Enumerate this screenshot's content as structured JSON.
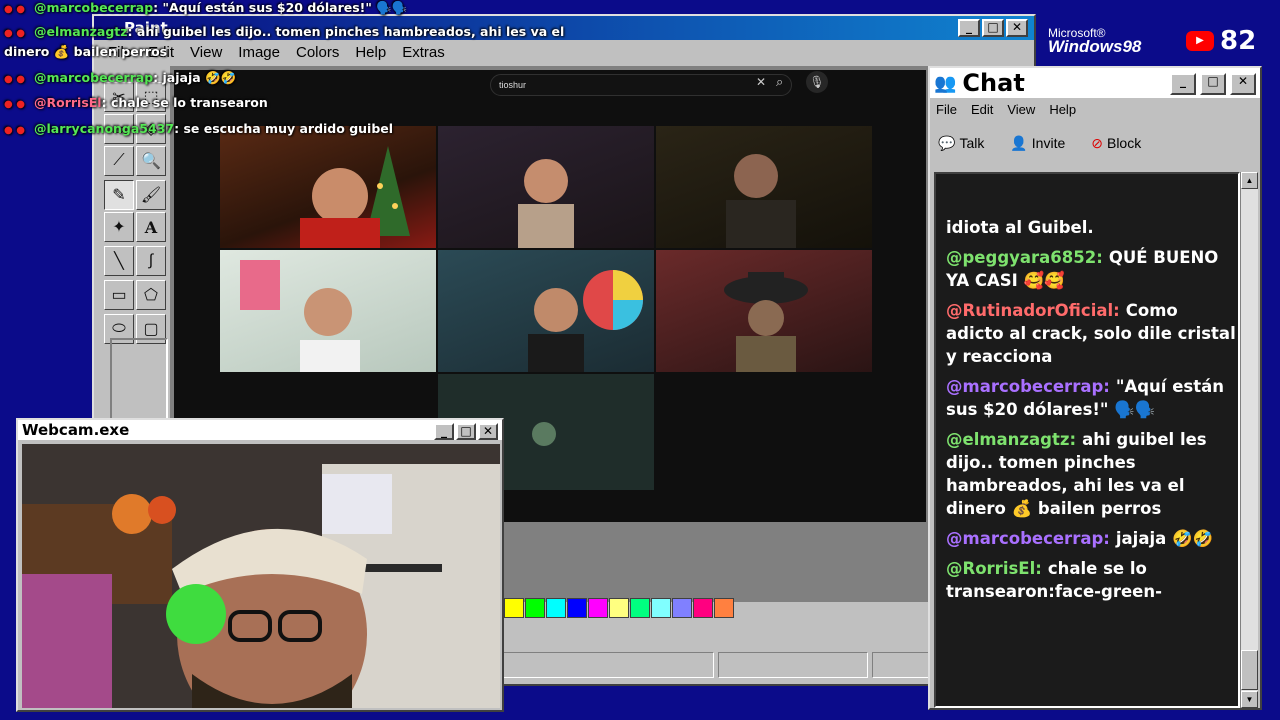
{
  "overlay_chat": [
    {
      "user": "@marcobecerrap",
      "text": ": \"Aquí están sus $20 dólares!\" 🗣️🗣️"
    },
    {
      "user": "@elmanzagtz",
      "text": ": ahi guibel les dijo.. tomen pinches hambreados, ahi les va el"
    },
    {
      "user": "",
      "text": "dinero 💰 bailen perros"
    },
    {
      "user": "@marcobecerrap",
      "text": ": jajaja 🤣🤣"
    },
    {
      "user": "@RorrisEl",
      "text": ": chale se lo transearon"
    },
    {
      "user": "@larrycanonga5437",
      "text": ": se escucha muy ardido guibel"
    }
  ],
  "paint": {
    "title": "Paint",
    "menu": [
      "File",
      "Edit",
      "View",
      "Image",
      "Colors",
      "Help",
      "Extras"
    ],
    "youtube_search": "tioshur",
    "palette": [
      "#ffff00",
      "#00ff00",
      "#00ffff",
      "#0000ff",
      "#ff00ff",
      "#ffff80",
      "#00ff80",
      "#80ffff",
      "#8080ff",
      "#ff0080",
      "#ff8040"
    ]
  },
  "webcam": {
    "title": "Webcam.exe"
  },
  "chat": {
    "title": "Chat",
    "menu": [
      "File",
      "Edit",
      "View",
      "Help"
    ],
    "toolbar": {
      "talk": "Talk",
      "invite": "Invite",
      "block": "Block"
    },
    "messages": [
      {
        "user": "",
        "user_color": "#ffffff",
        "text": "idiota al Guibel."
      },
      {
        "user": "@peggyara6852:",
        "user_color": "#7ee26e",
        "text": "QUÉ BUENO YA CASI 🥰🥰"
      },
      {
        "user": "@RutinadorOficial:",
        "user_color": "#ff6b6b",
        "text": "Como adicto al crack, solo dile cristal y reacciona"
      },
      {
        "user": "@marcobecerrap:",
        "user_color": "#a970ff",
        "text": "\"Aquí están sus $20 dólares!\" 🗣️🗣️"
      },
      {
        "user": "@elmanzagtz:",
        "user_color": "#7ee26e",
        "text": "ahi guibel les dijo.. tomen pinches hambreados, ahi les va el dinero 💰 bailen perros"
      },
      {
        "user": "@marcobecerrap:",
        "user_color": "#a970ff",
        "text": "jajaja 🤣🤣"
      },
      {
        "user": "@RorrisEl:",
        "user_color": "#7ee26e",
        "text": "chale se lo transearon:face-green-"
      }
    ]
  },
  "branding": {
    "microsoft": "Microsoft®",
    "windows": "Windows98",
    "viewer_count": "82"
  }
}
